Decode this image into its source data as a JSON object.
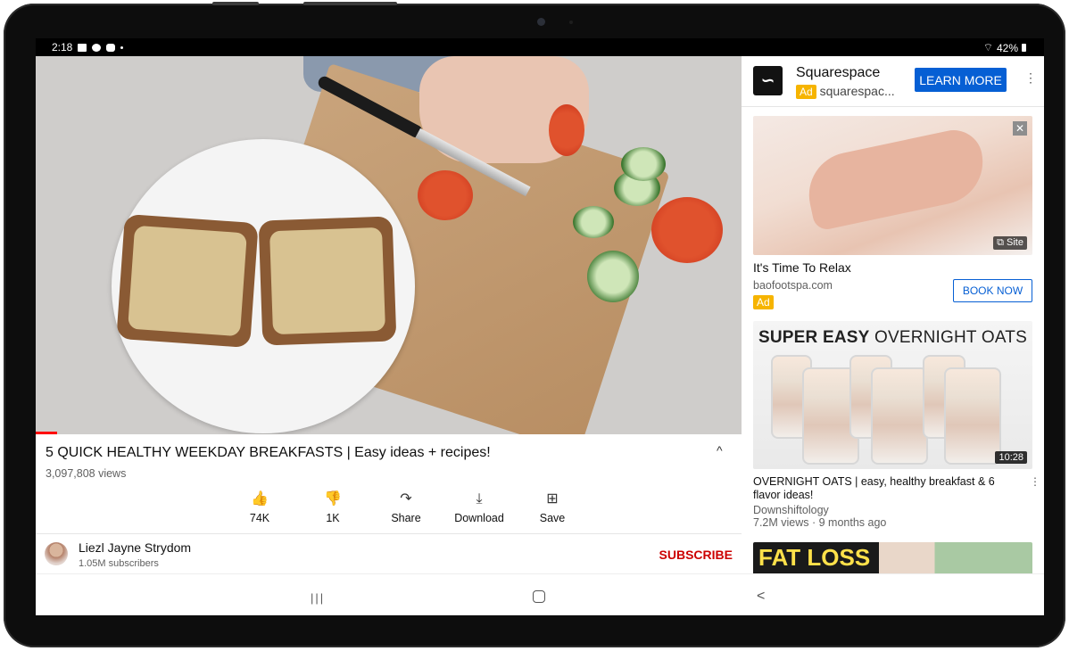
{
  "status": {
    "time": "2:18",
    "battery": "42%"
  },
  "video": {
    "title": "5 QUICK HEALTHY WEEKDAY BREAKFASTS | Easy ideas + recipes!",
    "views": "3,097,808 views",
    "progress": 0.03
  },
  "actions": [
    {
      "icon": "👍",
      "label": "74K"
    },
    {
      "icon": "👎",
      "label": "1K"
    },
    {
      "icon": "↷",
      "label": "Share"
    },
    {
      "icon": "⤓",
      "label": "Download"
    },
    {
      "icon": "⊞",
      "label": "Save"
    }
  ],
  "channel": {
    "name": "Liezl Jayne Strydom",
    "subs": "1.05M subscribers",
    "subscribe": "SUBSCRIBE"
  },
  "ad_top": {
    "name": "Squarespace",
    "badge": "Ad",
    "url": "squarespac...",
    "cta": "LEARN MORE"
  },
  "ad_card": {
    "title": "It's Time To Relax",
    "url": "baofootspa.com",
    "badge": "Ad",
    "cta": "BOOK NOW",
    "site": "Site",
    "close": "✕"
  },
  "rec": {
    "thumb_head_bold": "SUPER EASY",
    "thumb_head_rest": " OVERNIGHT OATS",
    "duration": "10:28",
    "title": "OVERNIGHT OATS | easy, healthy breakfast & 6 flavor ideas!",
    "channel": "Downshiftology",
    "meta": "7.2M views · 9 months ago"
  },
  "rec2": {
    "thumb_text": "FAT LOSS"
  },
  "nav": {
    "recent": "|||",
    "back": "<"
  }
}
